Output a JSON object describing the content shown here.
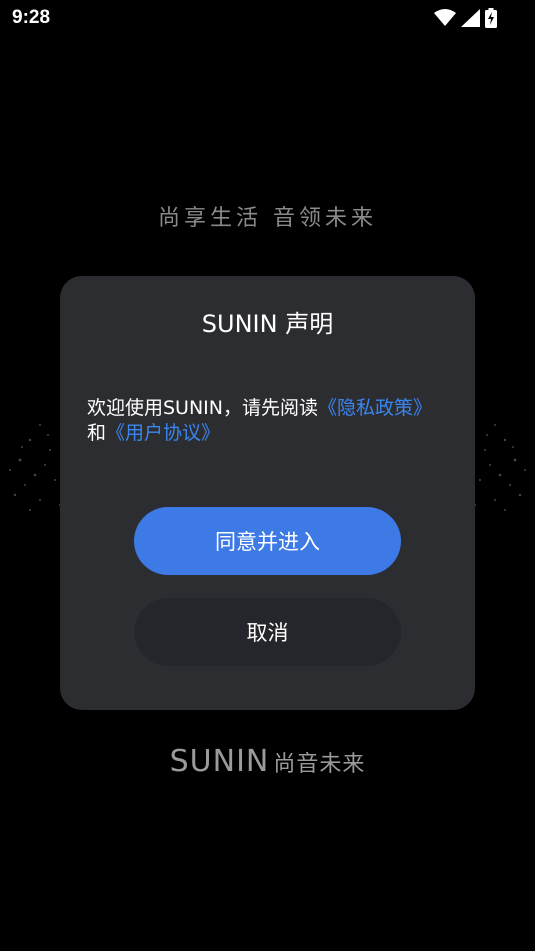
{
  "status_bar": {
    "time": "9:28",
    "icons": [
      "wifi-icon",
      "signal-icon",
      "battery-charging-icon"
    ]
  },
  "splash": {
    "slogan": "尚享生活 音领未来",
    "brand_logo": "SUNIN",
    "brand_sub": "尚音未来"
  },
  "dialog": {
    "title": "SUNIN 声明",
    "body_prefix": "欢迎使用SUNIN，请先阅读",
    "privacy_link": "《隐私政策》",
    "conjunction": "和",
    "agreement_link": "《用户协议》",
    "agree_button": "同意并进入",
    "cancel_button": "取消"
  },
  "colors": {
    "background": "#000000",
    "dialog": "#2c2d31",
    "accent": "#3e7ae6",
    "link": "#3a86f0",
    "cancel_button": "#25262b"
  }
}
